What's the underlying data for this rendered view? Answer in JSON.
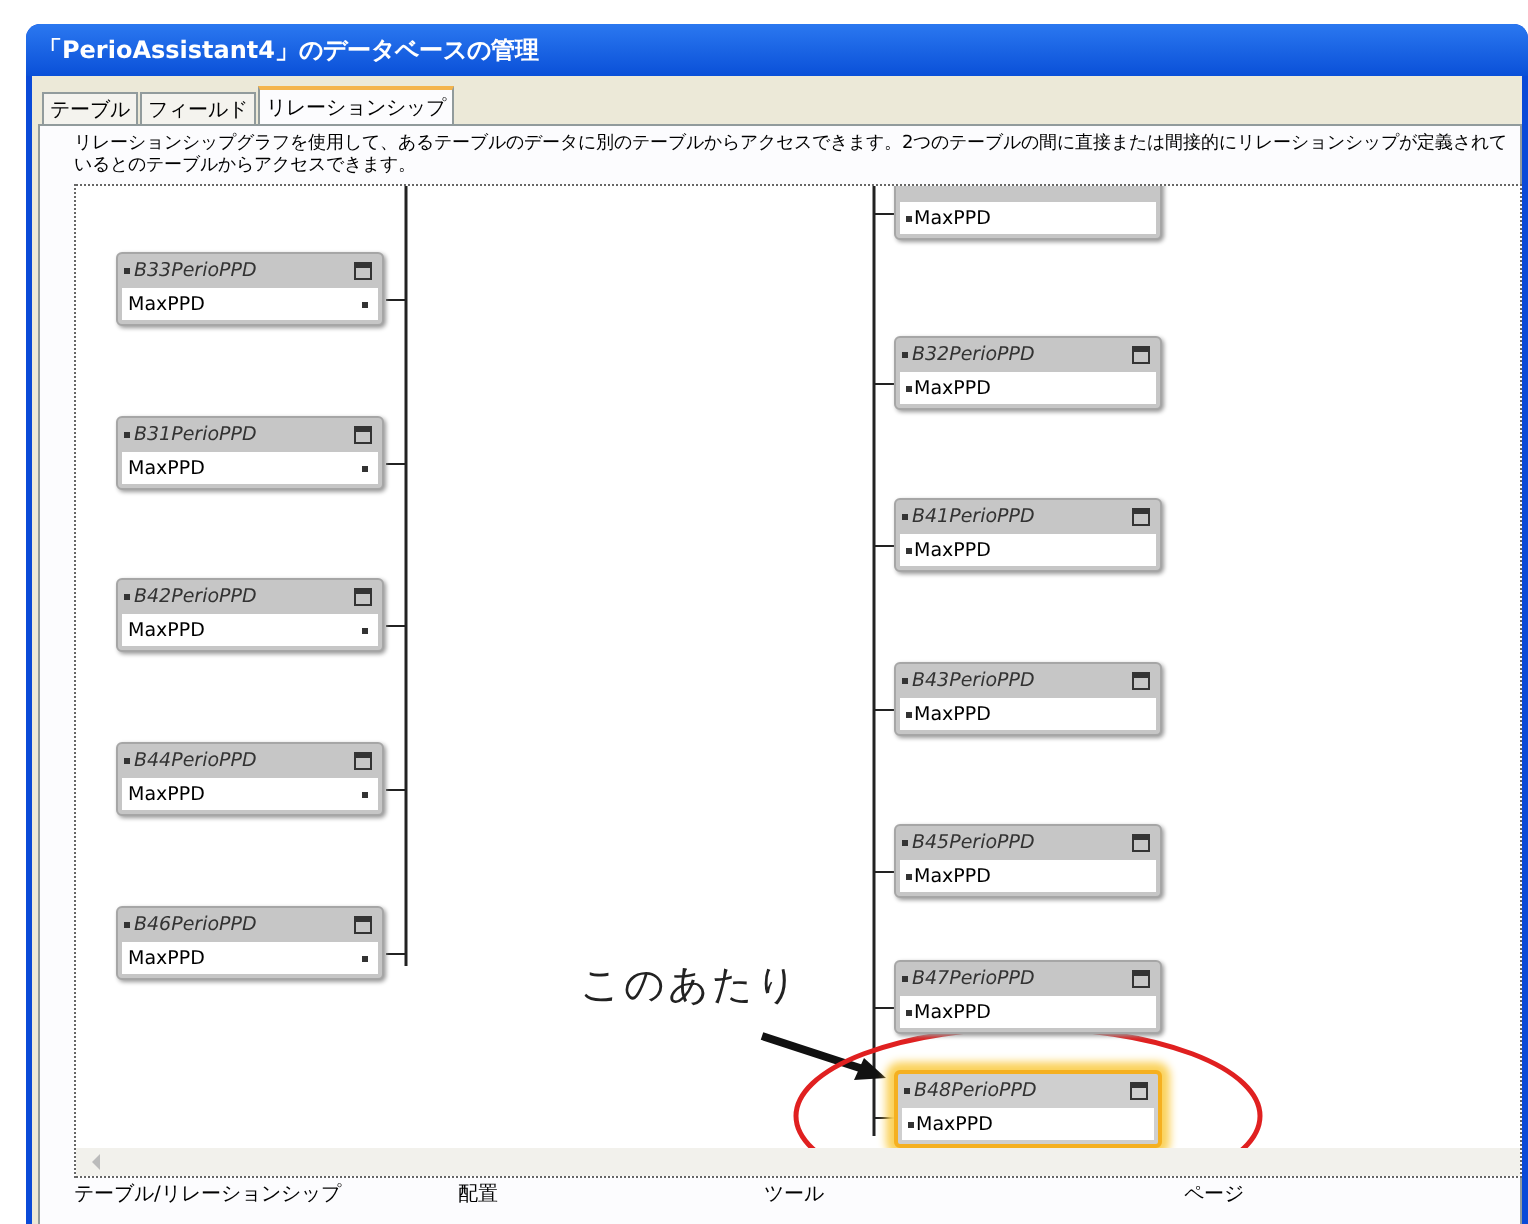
{
  "window": {
    "title": "「PerioAssistant4」のデータベースの管理"
  },
  "tabs": [
    {
      "label": "テーブル",
      "selected": false
    },
    {
      "label": "フィールド",
      "selected": false
    },
    {
      "label": "リレーションシップ",
      "selected": true
    }
  ],
  "description": "リレーションシップグラフを使用して、あるテーブルのデータに別のテーブルからアクセスできます。2つのテーブルの間に直接または間接的にリレーションシップが定義されているとのテーブルからアクセスできます。",
  "left_tables": [
    {
      "name": "B33PerioPPD",
      "field": "MaxPPD",
      "selected": false
    },
    {
      "name": "B31PerioPPD",
      "field": "MaxPPD",
      "selected": false
    },
    {
      "name": "B42PerioPPD",
      "field": "MaxPPD",
      "selected": false
    },
    {
      "name": "B44PerioPPD",
      "field": "MaxPPD",
      "selected": false
    },
    {
      "name": "B46PerioPPD",
      "field": "MaxPPD",
      "selected": false
    }
  ],
  "right_tables": [
    {
      "field": "MaxPPD",
      "selected": false
    },
    {
      "name": "B32PerioPPD",
      "field": "MaxPPD",
      "selected": false
    },
    {
      "name": "B41PerioPPD",
      "field": "MaxPPD",
      "selected": false
    },
    {
      "name": "B43PerioPPD",
      "field": "MaxPPD",
      "selected": false
    },
    {
      "name": "B45PerioPPD",
      "field": "MaxPPD",
      "selected": false
    },
    {
      "name": "B47PerioPPD",
      "field": "MaxPPD",
      "selected": false
    },
    {
      "name": "B48PerioPPD",
      "field": "MaxPPD",
      "selected": true
    }
  ],
  "annotation": "このあたり",
  "bottom_labels": [
    "テーブル/リレーションシップ",
    "配置",
    "ツール",
    "ページ"
  ]
}
